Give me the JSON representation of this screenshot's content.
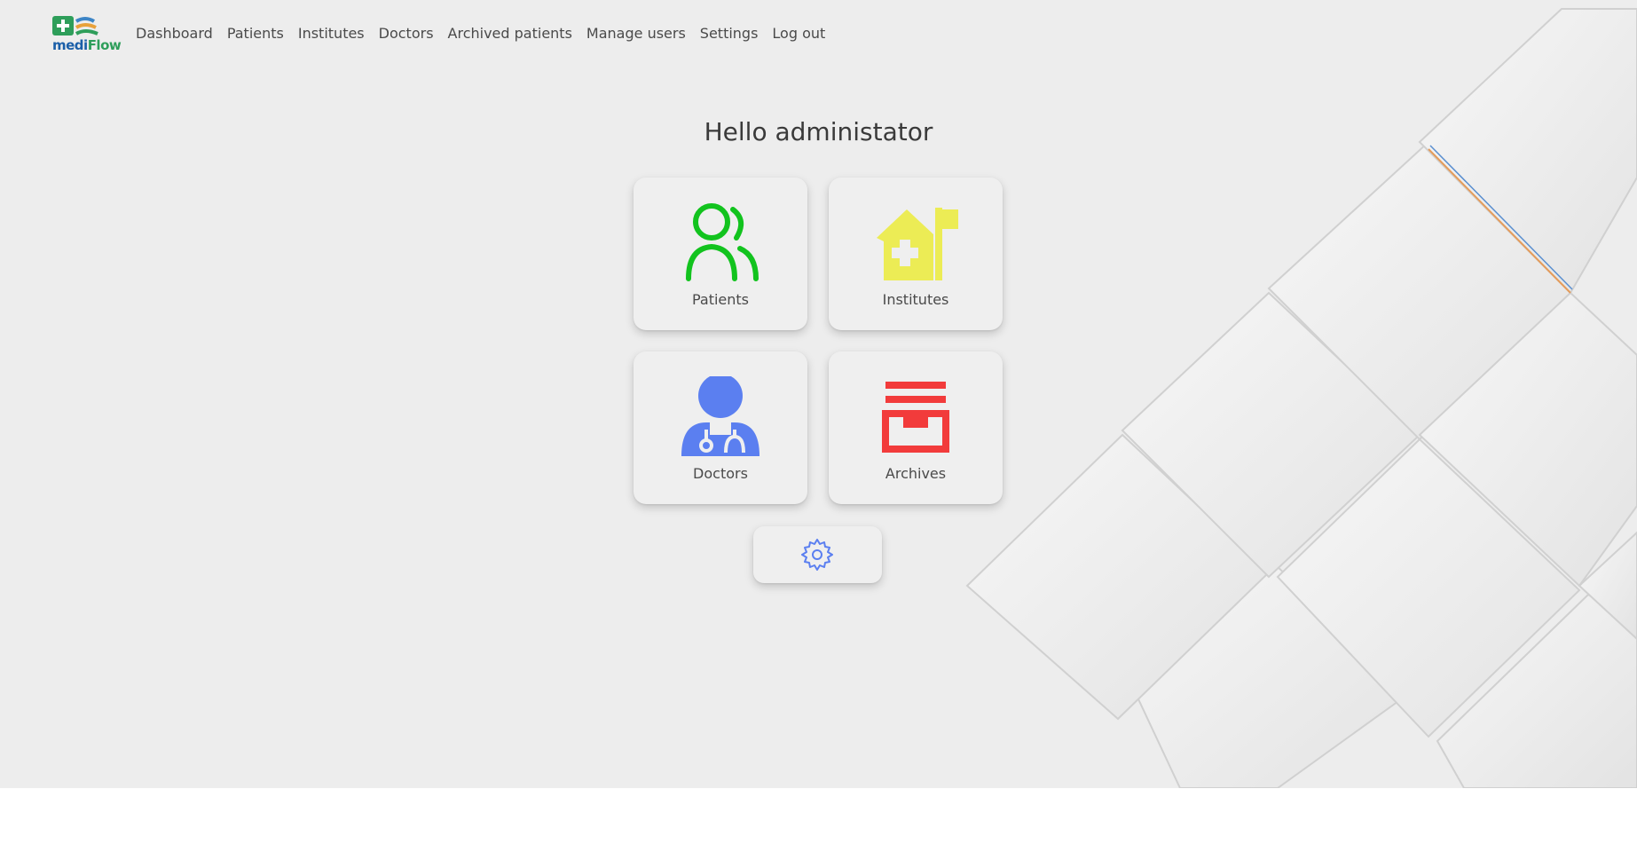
{
  "brand": {
    "name_part1": "medi",
    "name_part2": "Flow"
  },
  "nav": {
    "items": [
      {
        "label": "Dashboard"
      },
      {
        "label": "Patients"
      },
      {
        "label": "Institutes"
      },
      {
        "label": "Doctors"
      },
      {
        "label": "Archived patients"
      },
      {
        "label": "Manage users"
      },
      {
        "label": "Settings"
      },
      {
        "label": "Log out"
      }
    ]
  },
  "main": {
    "greeting": "Hello administator",
    "tiles": [
      {
        "label": "Patients",
        "icon": "patients-icon",
        "color": "#12c31e"
      },
      {
        "label": "Institutes",
        "icon": "institute-icon",
        "color": "#ecec55"
      },
      {
        "label": "Doctors",
        "icon": "doctor-icon",
        "color": "#5b7ff0"
      },
      {
        "label": "Archives",
        "icon": "archive-icon",
        "color": "#f23b3b"
      }
    ],
    "settings_button": {
      "icon": "gear-icon",
      "color": "#5b7ff0"
    }
  }
}
